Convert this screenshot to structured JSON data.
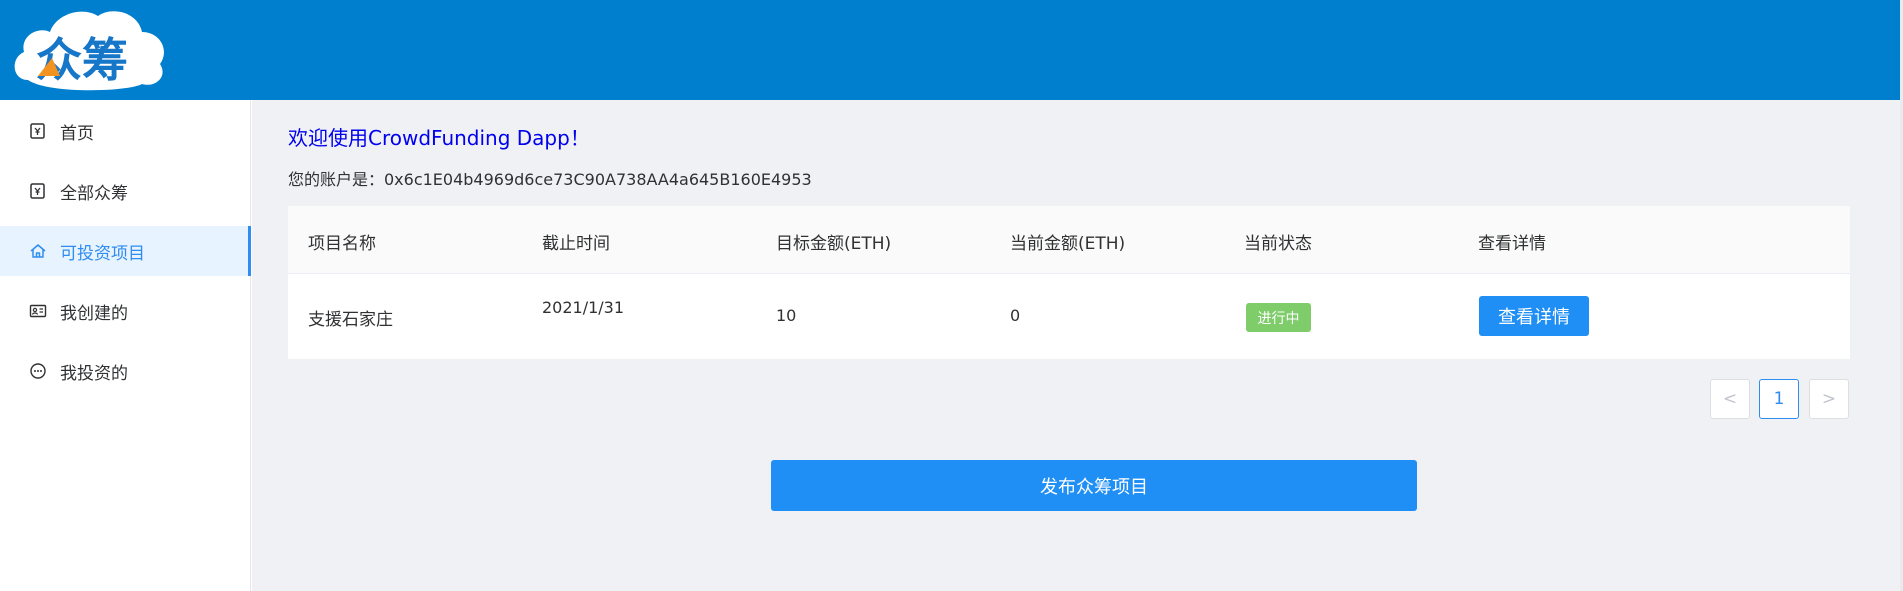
{
  "header": {
    "logo_text": "众筹",
    "background": "#007fce"
  },
  "sidebar": {
    "items": [
      {
        "label": "首页",
        "icon": "yen-tag-icon",
        "active": false
      },
      {
        "label": "全部众筹",
        "icon": "yen-tag-icon",
        "active": false
      },
      {
        "label": "可投资项目",
        "icon": "home-icon",
        "active": true
      },
      {
        "label": "我创建的",
        "icon": "id-card-icon",
        "active": false
      },
      {
        "label": "我投资的",
        "icon": "chat-dots-icon",
        "active": false
      }
    ]
  },
  "main": {
    "welcome": "欢迎使用CrowdFunding Dapp！",
    "account_label": "您的账户是：0x6c1E04b4969d6ce73C90A738AA4a645B160E4953",
    "table": {
      "columns": [
        "项目名称",
        "截止时间",
        "目标金额(ETH)",
        "当前金额(ETH)",
        "当前状态",
        "查看详情"
      ],
      "rows": [
        {
          "name": "支援石家庄",
          "deadline": "2021/1/31",
          "target": "10",
          "current": "0",
          "status": "进行中",
          "action": "查看详情"
        }
      ]
    },
    "pagination": {
      "prev": "<",
      "current_page": "1",
      "next": ">"
    },
    "publish_button": "发布众筹项目"
  },
  "colors": {
    "primary": "#1f8ff5",
    "active_bg": "#e7f3fe",
    "status_green": "#7fcc6b",
    "welcome_blue": "#0000ee"
  }
}
